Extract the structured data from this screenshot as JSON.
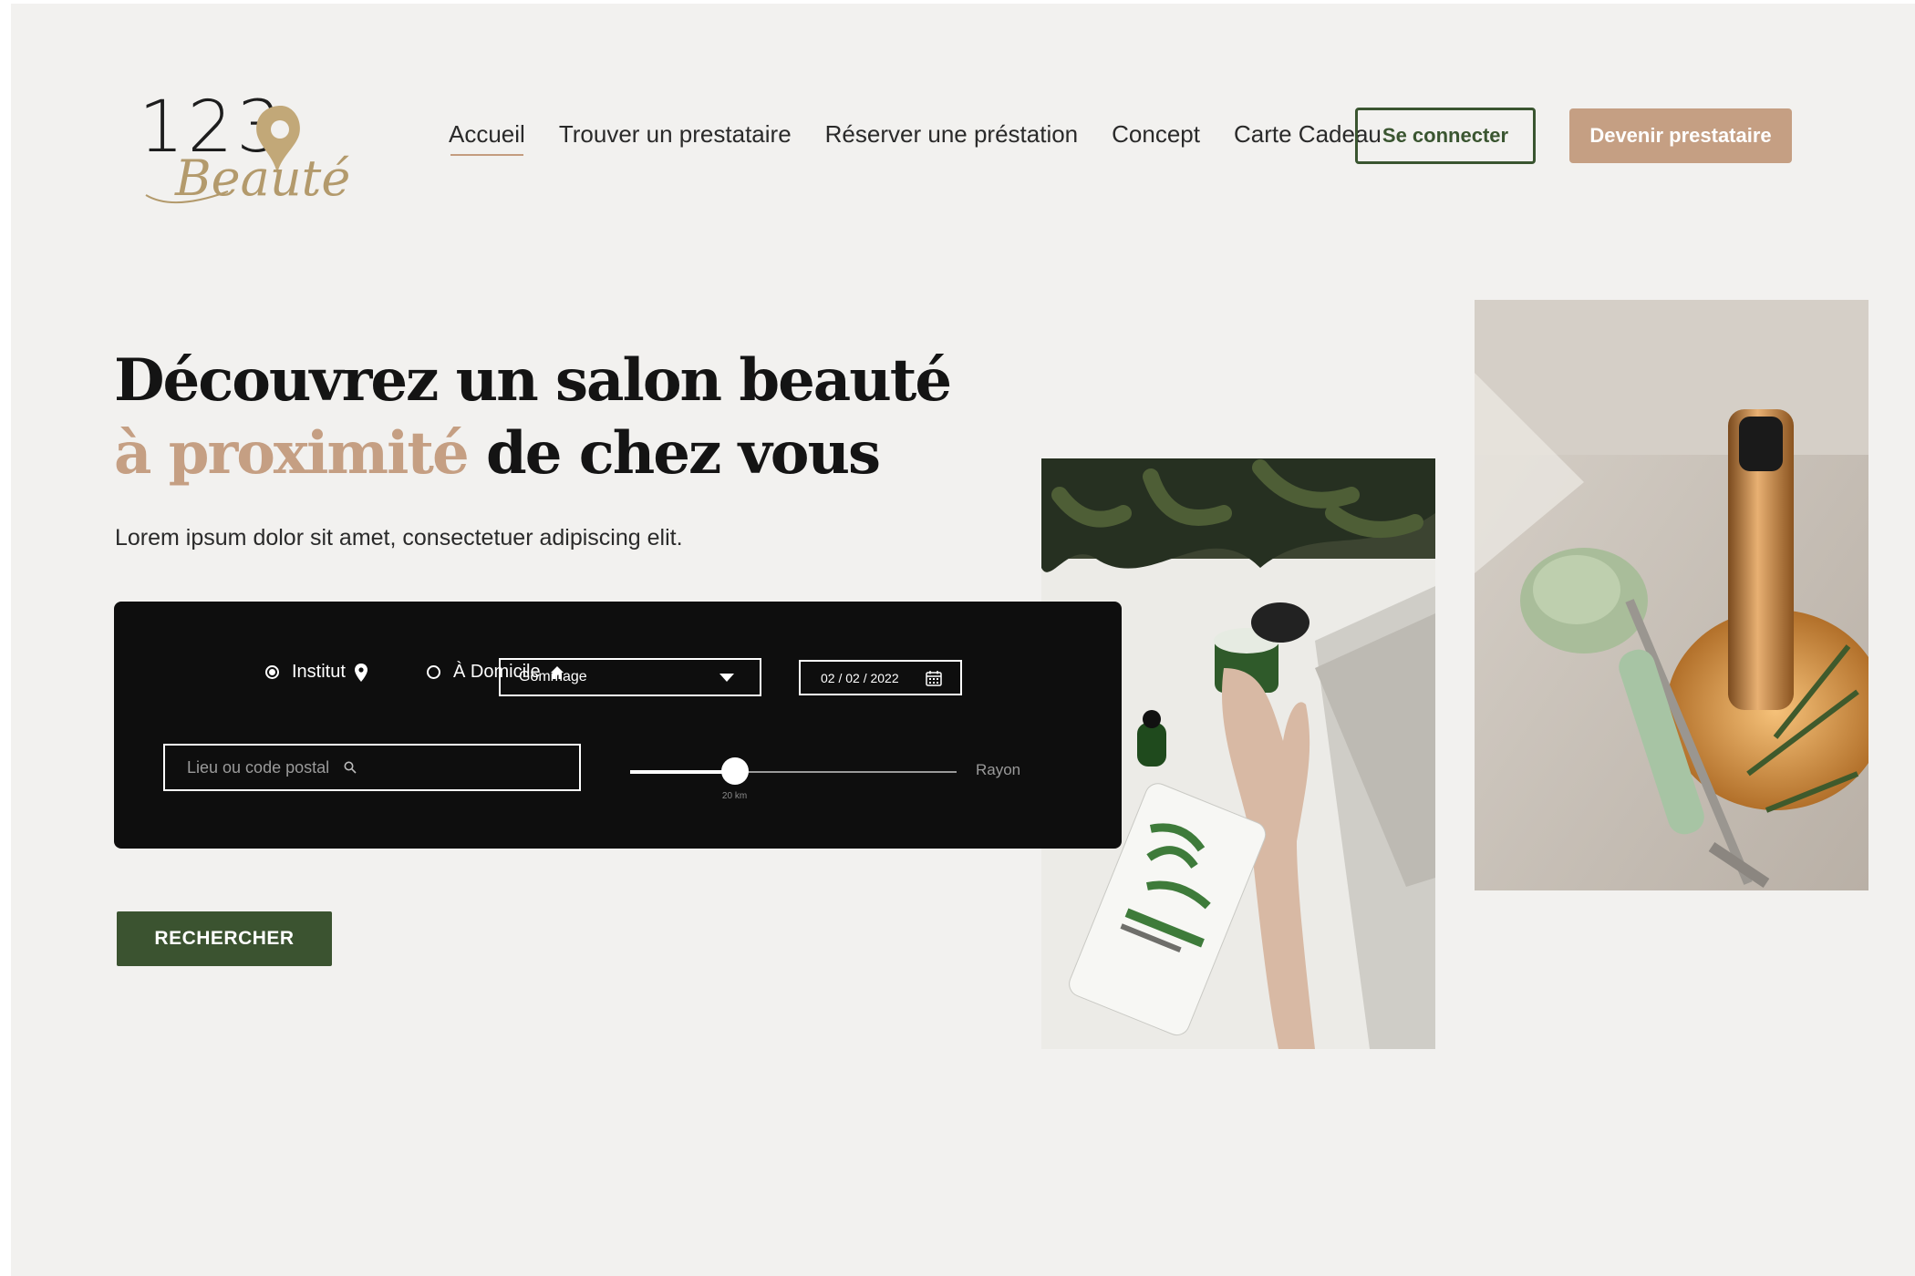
{
  "brand": {
    "logo_digits": "123",
    "logo_script": "Beauté"
  },
  "nav": {
    "items": [
      {
        "label": "Accueil",
        "active": true
      },
      {
        "label": "Trouver un prestataire",
        "active": false
      },
      {
        "label": "Réserver une préstation",
        "active": false
      },
      {
        "label": "Concept",
        "active": false
      },
      {
        "label": "Carte Cadeau",
        "active": false
      }
    ],
    "login_label": "Se connecter",
    "pro_label": "Devenir prestataire"
  },
  "hero": {
    "title_line1": "Découvrez un salon beauté",
    "title_accent": "à proximité",
    "title_line2_rest": " de chez vous",
    "subtitle": "Lorem ipsum dolor sit amet, consectetuer adipiscing elit."
  },
  "search": {
    "location_modes": [
      {
        "label": "Institut",
        "icon": "map-pin-icon",
        "selected": true
      },
      {
        "label": "À Domicile",
        "icon": "home-icon",
        "selected": false
      }
    ],
    "service": {
      "selected": "Gommage"
    },
    "date": {
      "value": "02 / 02 / 2022",
      "icon": "calendar-icon"
    },
    "place": {
      "placeholder": "Lieu ou code postal",
      "value": "",
      "icon": "search-icon"
    },
    "radius": {
      "label": "Rayon",
      "value_label": "20 km",
      "level": 0.32
    },
    "submit_label": "RECHERCHER"
  },
  "colors": {
    "background": "#f2f1ef",
    "accent_tan": "#c59f83",
    "forest_green": "#3b5330",
    "panel": "#0e0e0e"
  },
  "images": [
    {
      "name": "skincare-photo",
      "subject": "hand reaching toward green skincare jars and a sheet mask on white table"
    },
    {
      "name": "jade-roller-photo",
      "subject": "jade facial roller with gold bottle and rosemary sprig"
    }
  ]
}
